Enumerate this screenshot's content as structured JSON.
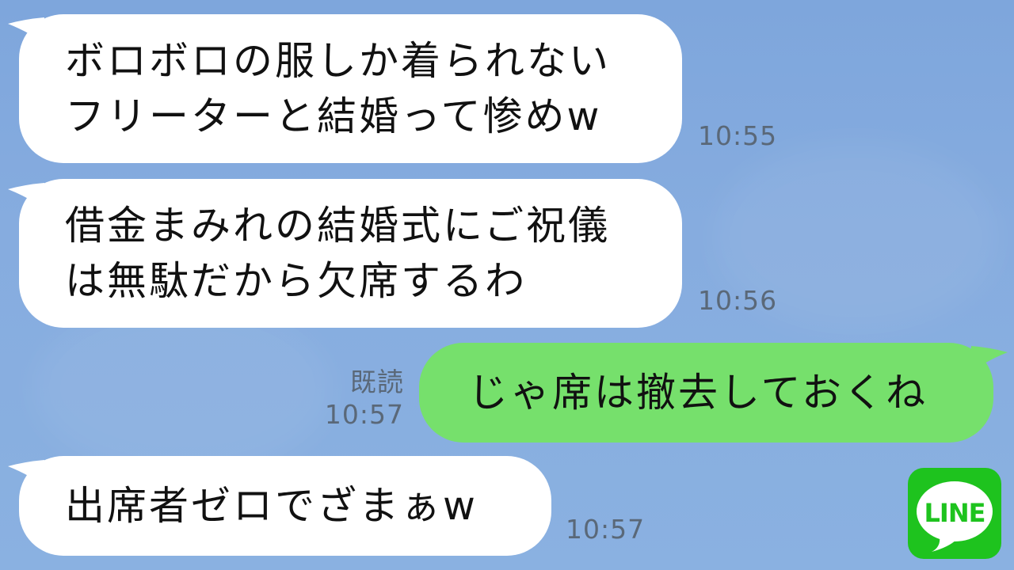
{
  "messages": [
    {
      "id": "msg1",
      "sender": "other",
      "lines": [
        "ボロボロの服しか着られない",
        "フリーターと結婚って惨めw"
      ],
      "time": "10:55"
    },
    {
      "id": "msg2",
      "sender": "other",
      "lines": [
        "借金まみれの結婚式にご祝儀",
        "は無駄だから欠席するわ"
      ],
      "time": "10:56"
    },
    {
      "id": "msg3",
      "sender": "me",
      "lines": [
        "じゃ席は撤去しておくね"
      ],
      "read_label": "既読",
      "time": "10:57"
    },
    {
      "id": "msg4",
      "sender": "other",
      "lines": [
        "出席者ゼロでざまぁw"
      ],
      "time": "10:57"
    }
  ],
  "logo": {
    "text": "LINE",
    "icon": "line-logo-icon",
    "color": "#1ec31e"
  },
  "colors": {
    "background": "#84aade",
    "incoming_bubble": "#ffffff",
    "outgoing_bubble": "#76e06c",
    "meta_text": "#5a6878"
  }
}
